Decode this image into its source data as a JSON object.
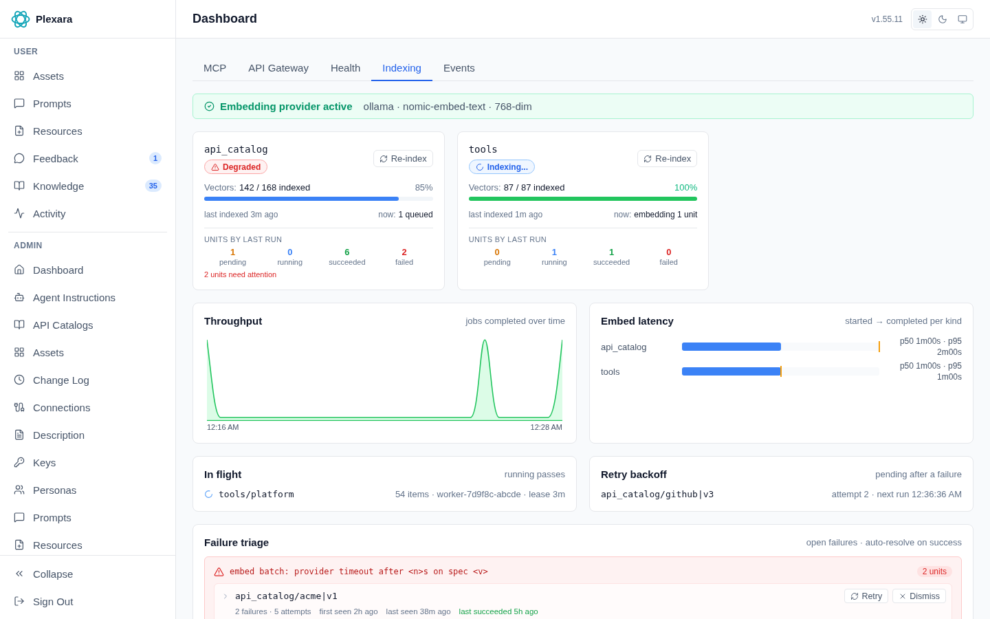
{
  "sidebar": {
    "brand": "Plexara",
    "sections": [
      {
        "title": "USER",
        "items": [
          {
            "label": "Assets",
            "selected": false
          },
          {
            "label": "Prompts",
            "selected": false
          },
          {
            "label": "Resources",
            "selected": false
          },
          {
            "label": "Feedback",
            "badge": "1",
            "selected": false
          },
          {
            "label": "Knowledge",
            "badge": "35",
            "selected": false
          },
          {
            "label": "Activity",
            "selected": false
          }
        ]
      },
      {
        "title": "ADMIN",
        "items": [
          {
            "label": "Dashboard",
            "selected": false
          },
          {
            "label": "Agent Instructions",
            "selected": false
          },
          {
            "label": "API Catalogs",
            "selected": false
          },
          {
            "label": "Assets",
            "selected": false
          },
          {
            "label": "Change Log",
            "selected": false
          },
          {
            "label": "Connections",
            "selected": false
          },
          {
            "label": "Description",
            "selected": false
          },
          {
            "label": "Keys",
            "selected": false
          },
          {
            "label": "Personas",
            "selected": false
          },
          {
            "label": "Prompts",
            "selected": false
          },
          {
            "label": "Resources",
            "selected": false
          }
        ]
      }
    ],
    "footer": [
      {
        "label": "Collapse"
      },
      {
        "label": "Sign Out"
      }
    ]
  },
  "header": {
    "title": "Dashboard",
    "version": "v1.55.11",
    "theme_toggle": [
      {
        "selected": true
      },
      {
        "selected": false
      },
      {
        "selected": false
      }
    ]
  },
  "tabs": [
    {
      "label": "MCP",
      "selected": false
    },
    {
      "label": "API Gateway",
      "selected": false
    },
    {
      "label": "Health",
      "selected": false
    },
    {
      "label": "Indexing",
      "selected": true
    },
    {
      "label": "Events",
      "selected": false
    }
  ],
  "provider_banner": {
    "title": "Embedding provider active",
    "detail": "ollama · nomic-embed-text · 768-dim"
  },
  "index_cards": [
    {
      "name": "api_catalog",
      "status": {
        "kind": "degraded",
        "label": "Degraded"
      },
      "action": "Re-index",
      "vectors_label": "Vectors:",
      "vectors_value": "142 / 168 indexed",
      "percent": "85%",
      "progress": {
        "level": 0.85
      },
      "last_indexed": "last indexed 3m ago",
      "now_label": "now:",
      "now_value": "1 queued",
      "units_title": "UNITS BY LAST RUN",
      "units": [
        {
          "kind": "pending",
          "value": "1",
          "label": "pending"
        },
        {
          "kind": "running",
          "value": "0",
          "label": "running"
        },
        {
          "kind": "succeeded",
          "value": "6",
          "label": "succeeded"
        },
        {
          "kind": "failed",
          "value": "2",
          "label": "failed"
        }
      ],
      "attention": "2 units need attention"
    },
    {
      "name": "tools",
      "status": {
        "kind": "indexing",
        "label": "Indexing..."
      },
      "action": "Re-index",
      "vectors_label": "Vectors:",
      "vectors_value": "87 / 87 indexed",
      "percent": "100%",
      "progress": {
        "level": 1
      },
      "last_indexed": "last indexed 1m ago",
      "now_label": "now:",
      "now_value": "embedding 1 unit",
      "units_title": "UNITS BY LAST RUN",
      "units": [
        {
          "kind": "pending",
          "value": "0",
          "label": "pending"
        },
        {
          "kind": "running",
          "value": "1",
          "label": "running"
        },
        {
          "kind": "succeeded",
          "value": "1",
          "label": "succeeded"
        },
        {
          "kind": "failed",
          "value": "0",
          "label": "failed"
        }
      ]
    }
  ],
  "throughput": {
    "title": "Throughput",
    "subtitle": "jobs completed over time",
    "x_labels": [
      "12:16 AM",
      "12:28 AM"
    ]
  },
  "embed_latency": {
    "title": "Embed latency",
    "subtitle": "started → completed per kind",
    "rows": [
      {
        "label": "api_catalog",
        "p50": {
          "level": 0.5
        },
        "p95": {
          "level": 1
        },
        "reading": "p50 1m00s · p95 2m00s"
      },
      {
        "label": "tools",
        "p50": {
          "level": 0.5
        },
        "p95": {
          "level": 0.5
        },
        "reading": "p50 1m00s · p95 1m00s"
      }
    ]
  },
  "in_flight": {
    "title": "In flight",
    "subtitle": "running passes",
    "items": [
      {
        "name": "tools/platform",
        "detail": "54 items · worker-7d9f8c-abcde · lease 3m"
      }
    ]
  },
  "retry_backoff": {
    "title": "Retry backoff",
    "subtitle": "pending after a failure",
    "items": [
      {
        "name": "api_catalog/github|v3",
        "detail": "attempt 2 · next run 12:36:36 AM"
      }
    ]
  },
  "failure_triage": {
    "title": "Failure triage",
    "subtitle": "open failures · auto-resolve on success",
    "groups": [
      {
        "message": "embed batch: provider timeout after <n>s on spec <v>",
        "count": "2 units",
        "items": [
          {
            "name": "api_catalog/acme|v1",
            "expanded": false,
            "actions": [
              {
                "kind": "retry",
                "label": "Retry"
              },
              {
                "kind": "dismiss",
                "label": "Dismiss"
              }
            ],
            "meta": [
              {
                "kind": "plain",
                "text": "2 failures · 5 attempts"
              },
              {
                "kind": "plain",
                "text": "first seen 2h ago"
              },
              {
                "kind": "plain",
                "text": "last seen 38m ago"
              },
              {
                "kind": "success",
                "text": "last succeeded 5h ago"
              }
            ]
          }
        ]
      }
    ]
  }
}
